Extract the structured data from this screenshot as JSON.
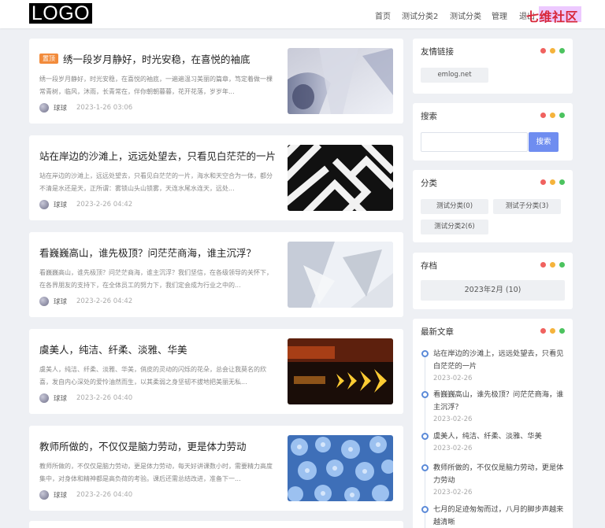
{
  "header": {
    "logo": "LOGO",
    "nav": [
      "首页",
      "测试分类2",
      "测试分类",
      "管理",
      "退出"
    ],
    "watermark": "七维社区"
  },
  "posts": [
    {
      "badge": "置顶",
      "title": "绣一段岁月静好，时光安稳，在喜悦的袖底",
      "excerpt": "绣一段岁月静好，时光安稳，在喜悦的袖底，一遍遍温习美丽的篇章，笃定着做一棵常青树，临风，沐雨，长青常在，伴你朝朝暮暮，花开花落，岁岁年...",
      "author": "球球",
      "date": "2023-1-26 03:06"
    },
    {
      "badge": "",
      "title": "站在岸边的沙滩上，远远处望去，只看见白茫茫的一片",
      "excerpt": "站在岸边的沙滩上，远远处望去，只看见白茫茫的一片，海水和天空合为一体，都分不清是水还是天，正所谓：雾锁山头山锁雾，天连水尾水连天，远处...",
      "author": "球球",
      "date": "2023-2-26 04:42"
    },
    {
      "badge": "",
      "title": "看巍巍高山，谁先极顶？问茫茫商海，谁主沉浮？",
      "excerpt": "看巍巍高山，谁先极顶？问茫茫商海，谁主沉浮？我们坚信，在各级领导的关怀下，在各界朋友的支持下，在全体员工的努力下，我们定会成为行业之中的...",
      "author": "球球",
      "date": "2023-2-26 04:42"
    },
    {
      "badge": "",
      "title": "虞美人，纯洁、纤柔、淡雅、华美",
      "excerpt": "虞美人，纯洁、纤柔、淡雅、华美，俏皮的灵动的闪烁的花朵，总会让我莫名的欣喜，发自内心深处的爱怜油然而生，以其柔弱之身坚韧不拔地把美丽无私...",
      "author": "球球",
      "date": "2023-2-26 04:40"
    },
    {
      "badge": "",
      "title": "教师所做的，不仅仅是脑力劳动，更是体力劳动",
      "excerpt": "教师所做的，不仅仅是脑力劳动，更是体力劳动，每天好讲课数小时，需要精力高度集中，对身体和精神都是高负荷的考验。课后还需总结改进，准备下一...",
      "author": "球球",
      "date": "2023-2-26 04:40"
    }
  ],
  "sidebar": {
    "links": {
      "title": "友情链接",
      "items": [
        "emlog.net"
      ]
    },
    "search": {
      "title": "搜索",
      "button": "搜索",
      "placeholder": ""
    },
    "categories": {
      "title": "分类",
      "items": [
        "测试分类(0)",
        "测试子分类(3)",
        "测试分类2(6)"
      ]
    },
    "archive": {
      "title": "存档",
      "items": [
        "2023年2月 (10)"
      ]
    },
    "recent": {
      "title": "最新文章",
      "items": [
        {
          "title": "站在岸边的沙滩上，远远处望去，只看见白茫茫的一片",
          "date": "2023-02-26"
        },
        {
          "title": "看巍巍高山，谁先极顶？问茫茫商海，谁主沉浮？",
          "date": "2023-02-26"
        },
        {
          "title": "虞美人，纯洁、纤柔、淡雅、华美",
          "date": "2023-02-26"
        },
        {
          "title": "教师所做的，不仅仅是脑力劳动，更是体力劳动",
          "date": "2023-02-26"
        },
        {
          "title": "七月的足迹匆匆而过，八月的脚步声越来越清晰",
          "date": ""
        }
      ]
    },
    "dot_colors": [
      "#f0625f",
      "#f5b33c",
      "#4cc35f"
    ]
  }
}
